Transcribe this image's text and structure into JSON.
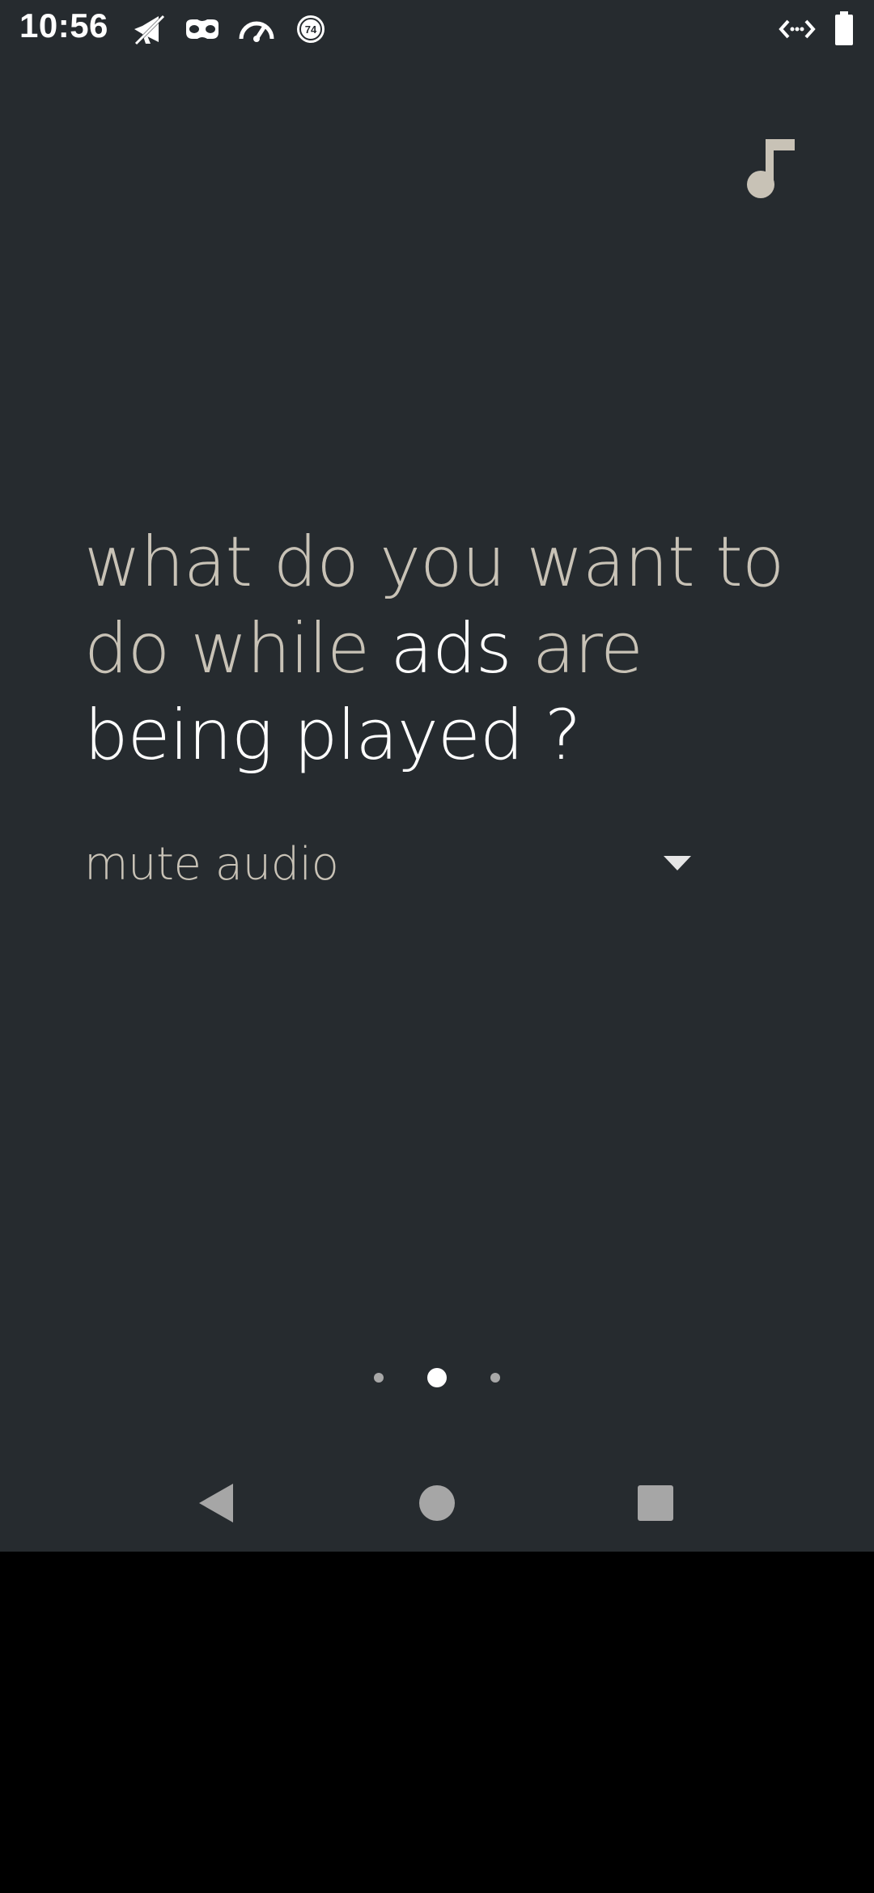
{
  "status_bar": {
    "time": "10:56",
    "left_icons": [
      "megaphone-icon",
      "mask-icon",
      "speedometer-icon",
      "badge-74-icon"
    ],
    "badge_number": "74",
    "right_icons": [
      "code-icon",
      "battery-icon"
    ]
  },
  "music_button": {
    "icon": "music-note-icon"
  },
  "question": {
    "part1": "what do you want to do while ",
    "highlight1": "ads",
    "part2": " are ",
    "highlight2": "being played ?"
  },
  "dropdown": {
    "selected": "mute audio"
  },
  "pager": {
    "pages": 3,
    "current": 2
  },
  "nav_bar": {
    "buttons": [
      "back",
      "home",
      "recents"
    ]
  },
  "colors": {
    "background": "#262b2f",
    "text_muted": "#c8c2b6",
    "text_highlight": "#ffffff",
    "music_icon": "#c8c2b6",
    "nav_icon": "#a6a6a6"
  }
}
